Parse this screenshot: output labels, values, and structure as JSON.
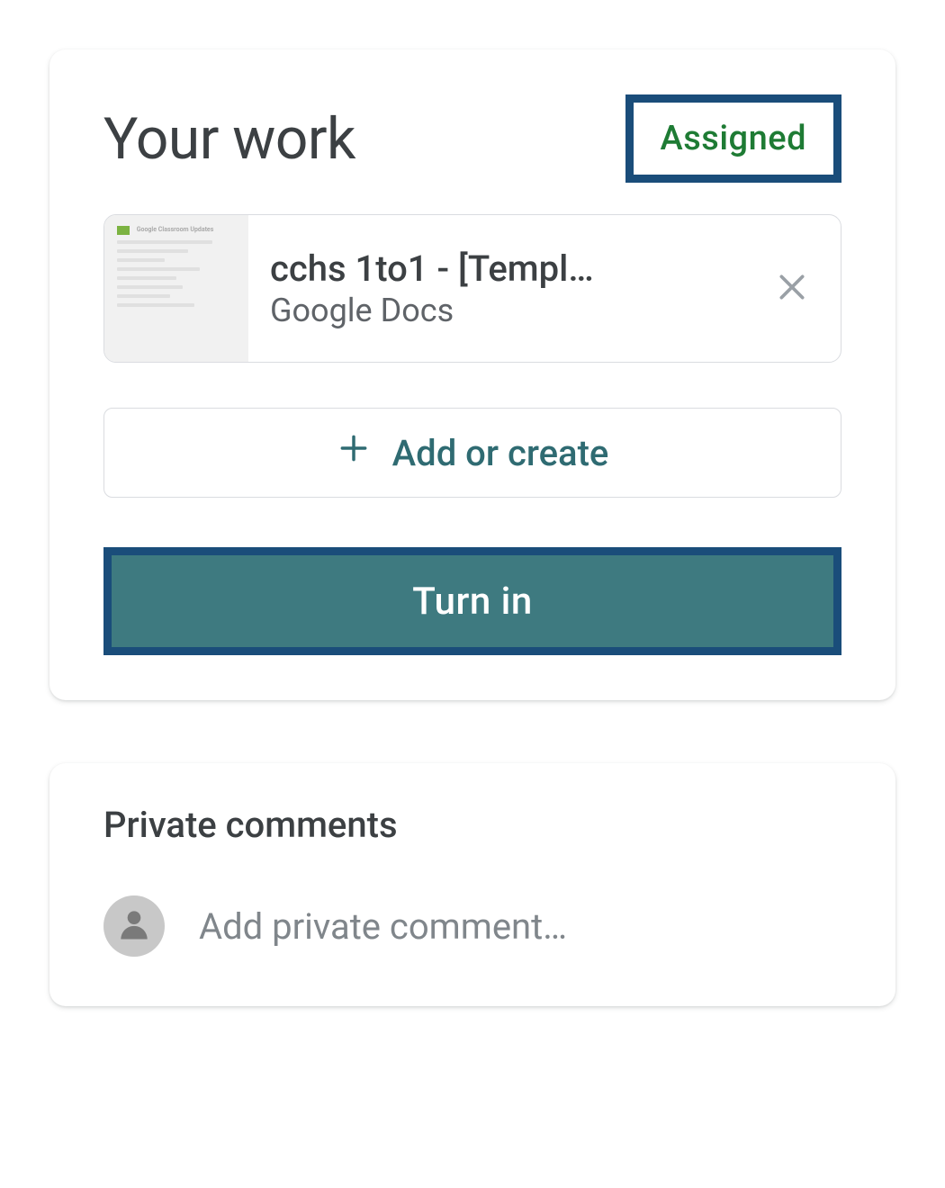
{
  "your_work": {
    "title": "Your work",
    "status": "Assigned",
    "attachment": {
      "title": "cchs 1to1 - [Templ…",
      "subtitle": "Google Docs",
      "thumb_header": "Google Classroom Updates"
    },
    "add_create_label": "Add or create",
    "turn_in_label": "Turn in"
  },
  "comments": {
    "title": "Private comments",
    "placeholder": "Add private comment…"
  }
}
